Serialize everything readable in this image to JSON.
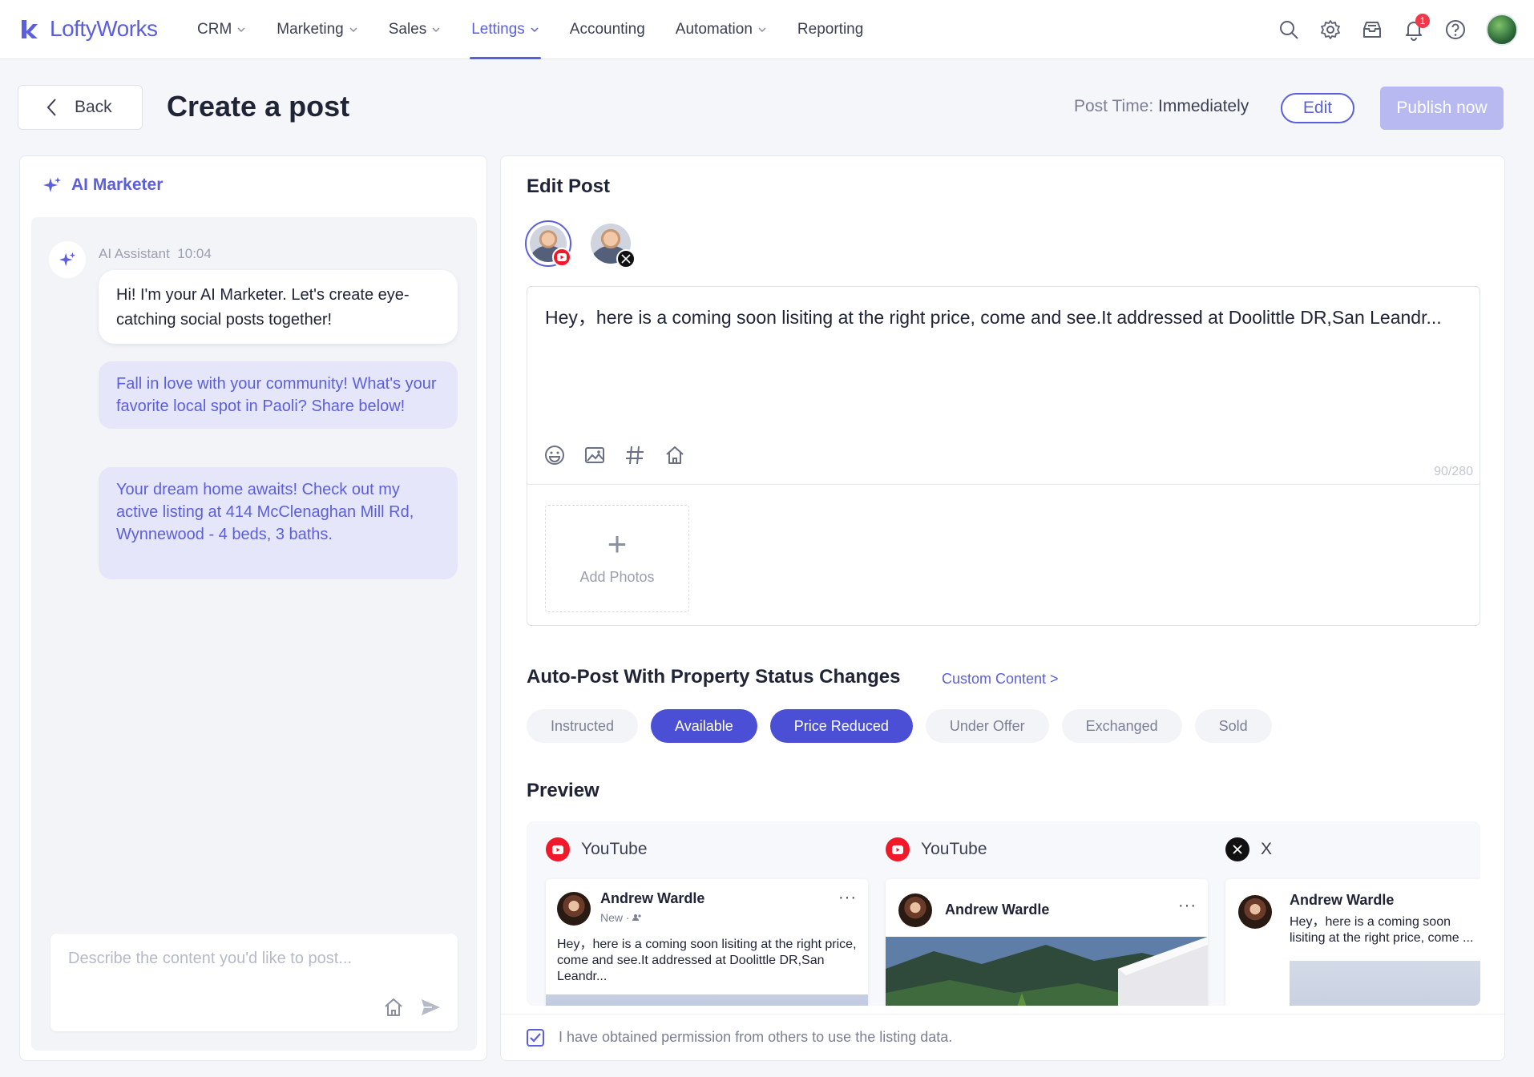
{
  "brand": {
    "name": "LoftyWorks",
    "accent": "#5b5fdc"
  },
  "nav": {
    "items": [
      {
        "label": "CRM",
        "dropdown": true,
        "active": false
      },
      {
        "label": "Marketing",
        "dropdown": true,
        "active": false
      },
      {
        "label": "Sales",
        "dropdown": true,
        "active": false
      },
      {
        "label": "Lettings",
        "dropdown": true,
        "active": true
      },
      {
        "label": "Accounting",
        "dropdown": false,
        "active": false
      },
      {
        "label": "Automation",
        "dropdown": true,
        "active": false
      },
      {
        "label": "Reporting",
        "dropdown": false,
        "active": false
      }
    ],
    "icons": [
      "search-icon",
      "gear-icon",
      "inbox-icon",
      "bell-icon",
      "help-icon"
    ],
    "notification_count": "1"
  },
  "header": {
    "back_label": "Back",
    "title": "Create a post",
    "post_time_label": "Post Time:",
    "post_time_value": "Immediately",
    "edit_label": "Edit",
    "publish_label": "Publish now"
  },
  "ai_panel": {
    "title": "AI Marketer",
    "assistant_name": "AI Assistant",
    "time": "10:04",
    "greeting": "Hi! I'm your AI Marketer. Let's create eye-catching social posts together!",
    "suggestions": [
      "Fall in love with your community! What's your favorite local spot in Paoli? Share below!",
      "Your dream home awaits! Check out my active listing at 414 McClenaghan Mill Rd, Wynnewood - 4 beds, 3 baths."
    ],
    "input_placeholder": "Describe the content you'd like to post..."
  },
  "edit_post": {
    "title": "Edit Post",
    "accounts": [
      {
        "network": "youtube",
        "selected": true
      },
      {
        "network": "x",
        "selected": false
      }
    ],
    "text": "Hey，here is a coming soon lisiting at the right price, come and see.It addressed at Doolittle DR,San Leandr...",
    "counter": "90/280",
    "add_photos_label": "Add Photos"
  },
  "auto_post": {
    "title": "Auto-Post With Property Status Changes",
    "custom_link": "Custom Content >",
    "statuses": [
      {
        "label": "Instructed",
        "selected": false
      },
      {
        "label": "Available",
        "selected": true
      },
      {
        "label": "Price Reduced",
        "selected": true
      },
      {
        "label": "Under Offer",
        "selected": false
      },
      {
        "label": "Exchanged",
        "selected": false
      },
      {
        "label": "Sold",
        "selected": false
      }
    ]
  },
  "preview": {
    "title": "Preview",
    "cards": [
      {
        "network": "YouTube",
        "author": "Andrew Wardle",
        "sub": "New · ",
        "text": "Hey，here is a coming soon lisiting at the right price, come and see.It addressed at Doolittle DR,San Leandr...",
        "menu": "···"
      },
      {
        "network": "YouTube",
        "author": "Andrew Wardle",
        "menu": "···"
      },
      {
        "network": "X",
        "author": "Andrew Wardle",
        "text": "Hey，here is a coming soon lisiting at the right price, come ..."
      }
    ]
  },
  "footer": {
    "permission_checked": true,
    "permission_text": "I have obtained permission from others to use the listing data."
  }
}
